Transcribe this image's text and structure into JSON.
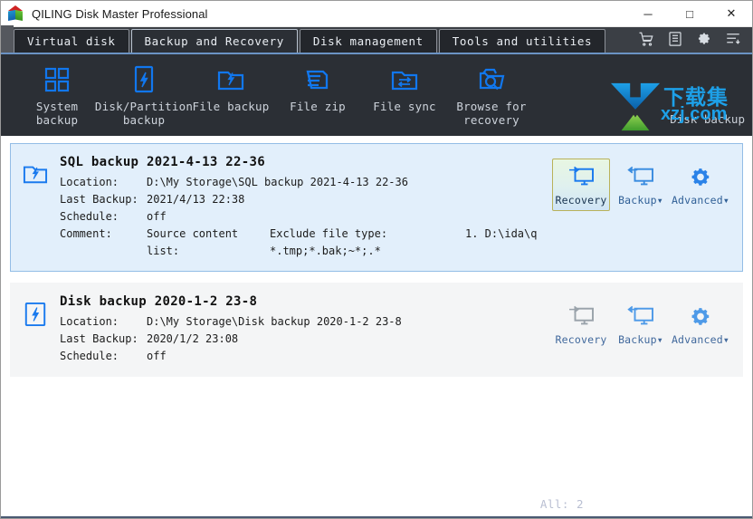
{
  "window": {
    "title": "QILING Disk Master Professional",
    "logo_icon": "cube-logo-icon",
    "minimize_label": "─",
    "maximize_label": "□",
    "close_label": "✕"
  },
  "tabs": [
    {
      "label": "Virtual disk",
      "active": false
    },
    {
      "label": "Backup and Recovery",
      "active": true
    },
    {
      "label": "Disk management",
      "active": false
    },
    {
      "label": "Tools and utilities",
      "active": false
    }
  ],
  "tab_tools": [
    {
      "name": "cart-icon"
    },
    {
      "name": "log-list-icon"
    },
    {
      "name": "gear-icon"
    },
    {
      "name": "menu-icon"
    }
  ],
  "actions": [
    {
      "label": "System backup",
      "icon": "grid-squares-icon"
    },
    {
      "label": "Disk/Partition backup",
      "icon": "disk-partition-icon"
    },
    {
      "label": "File backup",
      "icon": "folder-arrow-icon"
    },
    {
      "label": "File zip",
      "icon": "file-zip-icon"
    },
    {
      "label": "File sync",
      "icon": "folder-sync-icon"
    },
    {
      "label": "Browse for recovery",
      "icon": "folder-search-icon"
    }
  ],
  "watermark": {
    "cn_text": "下载集",
    "url_prefix": "xzj",
    "url_suffix": ".com",
    "hidden_label": "Disk backup",
    "arrow_icon": "download-arrow-icon"
  },
  "labels": {
    "location": "Location:",
    "last_backup": "Last Backup:",
    "schedule": "Schedule:",
    "comment": "Comment:"
  },
  "cards": [
    {
      "selected": true,
      "icon": "folder-backup-icon",
      "title": "SQL backup 2021-4-13 22-36",
      "location": "D:\\My Storage\\SQL backup 2021-4-13 22-36",
      "last_backup": "2021/4/13 22:38",
      "schedule": "off",
      "comment_seg1": "Source content list:",
      "comment_seg2": "Exclude file type: *.tmp;*.bak;~*;.*",
      "comment_seg3": "1. D:\\ida\\q",
      "buttons": [
        {
          "label": "Recovery",
          "icon": "recovery-monitor-icon",
          "state": "highlighted"
        },
        {
          "label": "Backup▾",
          "icon": "backup-monitor-icon",
          "state": "normal"
        },
        {
          "label": "Advanced▾",
          "icon": "gear-icon",
          "state": "normal"
        }
      ]
    },
    {
      "selected": false,
      "icon": "disk-backup-icon",
      "title": "Disk backup 2020-1-2 23-8",
      "location": "D:\\My Storage\\Disk backup 2020-1-2 23-8",
      "last_backup": "2020/1/2 23:08",
      "schedule": "off",
      "comment_seg1": "",
      "comment_seg2": "",
      "comment_seg3": "",
      "buttons": [
        {
          "label": "Recovery",
          "icon": "recovery-monitor-icon",
          "state": "disabled"
        },
        {
          "label": "Backup▾",
          "icon": "backup-monitor-icon",
          "state": "normal"
        },
        {
          "label": "Advanced▾",
          "icon": "gear-icon",
          "state": "normal"
        }
      ]
    }
  ],
  "footer": {
    "count_text": "All: 2"
  },
  "colors": {
    "accent_blue": "#1177ee",
    "dark_chrome": "#2b2f35",
    "tabstrip": "#3b3f45",
    "card_selected_bg": "#e2effb",
    "card_selected_border": "#93bde6",
    "card_bg": "#f4f5f6",
    "label_blue": "#2f5f96"
  }
}
